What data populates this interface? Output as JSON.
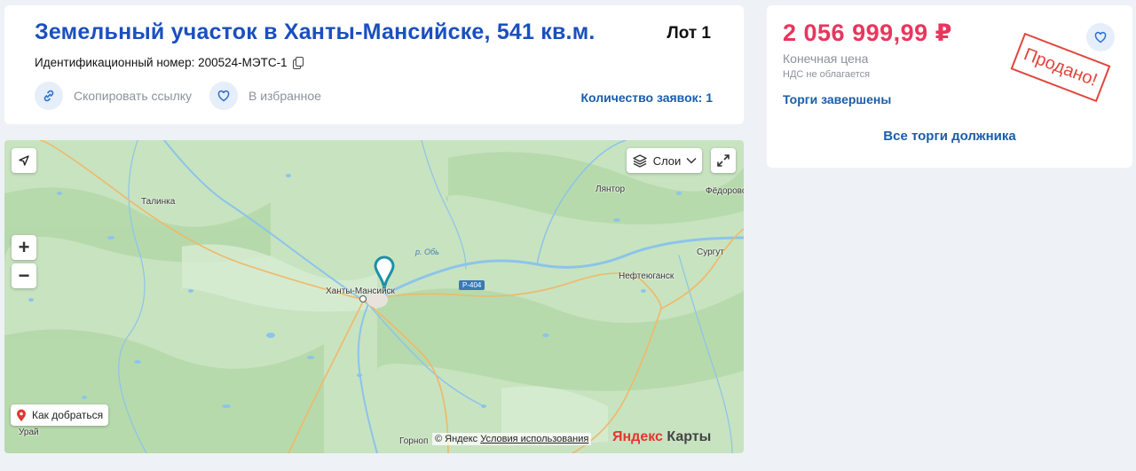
{
  "lot": {
    "title": "Земельный участок в Ханты-Мансийске, 541 кв.м.",
    "lot_number": "Лот 1",
    "ident_label": "Идентификационный номер: 200524-МЭТС-1",
    "copy_link_label": "Скопировать ссылку",
    "favorite_label": "В избранное",
    "bids_label": "Количество заявок: 1"
  },
  "price_panel": {
    "price": "2 056 999,99 ₽",
    "final_label": "Конечная цена",
    "vat_note": "НДС не облагается",
    "status": "Торги завершены",
    "all_trades_link": "Все торги должника",
    "stamp": "Продано!"
  },
  "map": {
    "layers_label": "Слои",
    "zoom_in": "+",
    "zoom_out": "−",
    "route_label": "Как добраться",
    "copyright_prefix": "© Яндекс",
    "terms_link": "Условия использования",
    "logo_ya": "Яндекс",
    "logo_maps": " Карты",
    "places": {
      "talinka": "Талинка",
      "khanty": "Ханты-Мансийск",
      "lyantor": "Лянтор",
      "fedorovsky": "Фёдоровс",
      "surgut": "Сургут",
      "nefteyugansk": "Нефтеюганск",
      "uray": "Урай",
      "gornopravdinsk": "Горноп"
    },
    "river": "р. Обь",
    "road": "Р-404"
  },
  "colors": {
    "title_blue": "#1a4fbf",
    "link_blue": "#1a5dab",
    "price_red": "#e8365d",
    "stamp_red": "#e0453c",
    "map_green": "#c7e2bf",
    "water": "#8cc4ea"
  }
}
